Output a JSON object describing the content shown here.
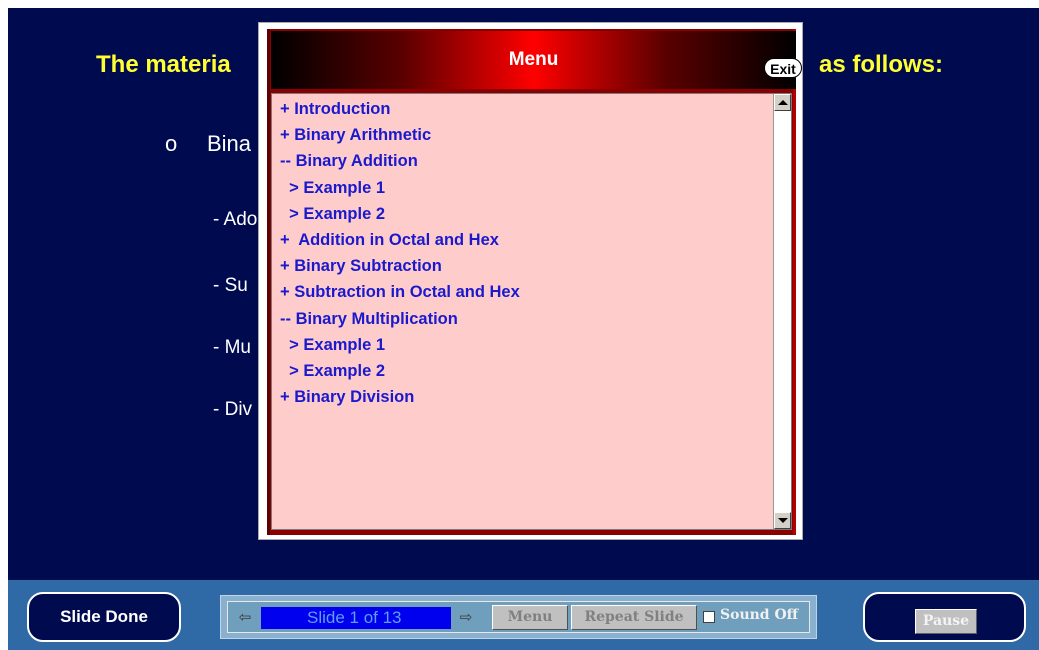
{
  "slide": {
    "title_left": "The materia",
    "title_right": "as follows:",
    "bullet_marker": "o",
    "bullet_text": "Bina",
    "sub_items": [
      "- Ado",
      "- Su",
      "- Mu",
      "- Div"
    ]
  },
  "menu": {
    "title": "Menu",
    "exit_label": "Exit",
    "items": [
      "+ Introduction",
      "+ Binary Arithmetic",
      "-- Binary Addition",
      "  > Example 1",
      "  > Example 2",
      "+  Addition in Octal and Hex",
      "+ Binary Subtraction",
      "+ Subtraction in Octal and Hex",
      "-- Binary Multiplication",
      "  > Example 1",
      "  > Example 2",
      "+ Binary Division"
    ]
  },
  "controls": {
    "slide_done_label": "Slide Done",
    "prev_icon": "⇦",
    "next_icon": "⇨",
    "slide_indicator": "Slide 1 of 13",
    "menu_label": "Menu",
    "repeat_label": "Repeat Slide",
    "sound_label": "Sound Off",
    "pause_label": "Pause"
  },
  "colors": {
    "slide_background": "#000a4f",
    "title_text": "#ffff33",
    "menu_item_text": "#1a1acc",
    "menu_list_background": "#ffcccc",
    "control_bar": "#2f6aa6"
  }
}
